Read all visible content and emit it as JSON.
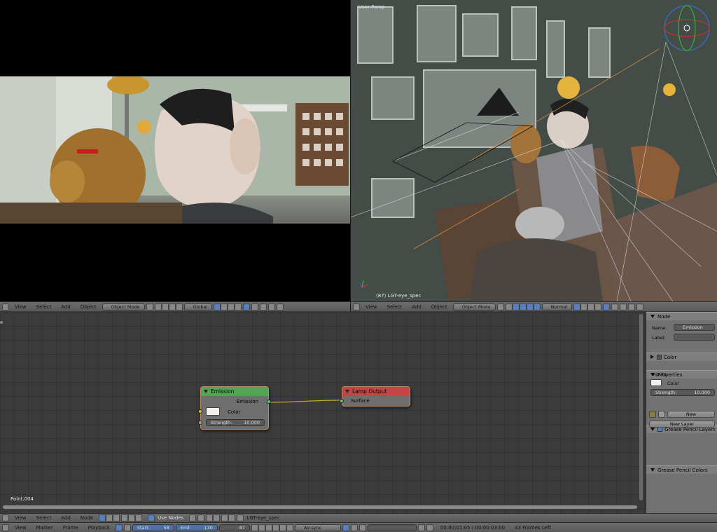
{
  "colors": {
    "emission_header": "#52a552",
    "lamp_output_header": "#c34646",
    "node_border": "#c38a55",
    "link": "#c8a03c",
    "socket_yellow": "#c7c729",
    "socket_green": "#63c763"
  },
  "viewport_right": {
    "view_label": "User Persp",
    "object_label": "(87) LGT-eye_spec"
  },
  "header_left": {
    "view": "View",
    "select": "Select",
    "add": "Add",
    "object": "Object",
    "mode": "Object Mode",
    "orientation": "Global"
  },
  "header_right": {
    "view": "View",
    "select": "Select",
    "add": "Add",
    "object": "Object",
    "mode": "Object Mode",
    "orientation": "Normal"
  },
  "node_editor": {
    "object_name": "Point.004",
    "emission_node": {
      "title": "Emission",
      "output": "Emission",
      "color_label": "Color",
      "strength_label": "Strength:",
      "strength_value": "10.000"
    },
    "lamp_output_node": {
      "title": "Lamp Output",
      "input": "Surface"
    }
  },
  "properties": {
    "node_section": "Node",
    "name_label": "Name:",
    "name_value": "Emission",
    "label_label": "Label:",
    "color_section": "Color",
    "properties_section": "Properties",
    "inputs_label": "Inputs:",
    "color_label": "Color",
    "strength_label": "Strength:",
    "strength_value": "10.000",
    "grease_layers": "Grease Pencil Layers",
    "new_button": "New",
    "new_layer_button": "New Layer",
    "grease_colors": "Grease Pencil Colors"
  },
  "node_header": {
    "view": "View",
    "select": "Select",
    "add": "Add",
    "node": "Node",
    "use_nodes": "Use Nodes",
    "object_name": "LGT-eye_spec"
  },
  "timeline": {
    "view": "View",
    "marker": "Marker",
    "frame": "Frame",
    "playback": "Playback",
    "start_label": "Start:",
    "start_value": "58",
    "end_label": "End:",
    "end_value": "130",
    "current": "87",
    "sync": "AV-sync",
    "time": "00:00:01:05 / 00:00:03:00",
    "frames_left": "43 Frames Left"
  }
}
